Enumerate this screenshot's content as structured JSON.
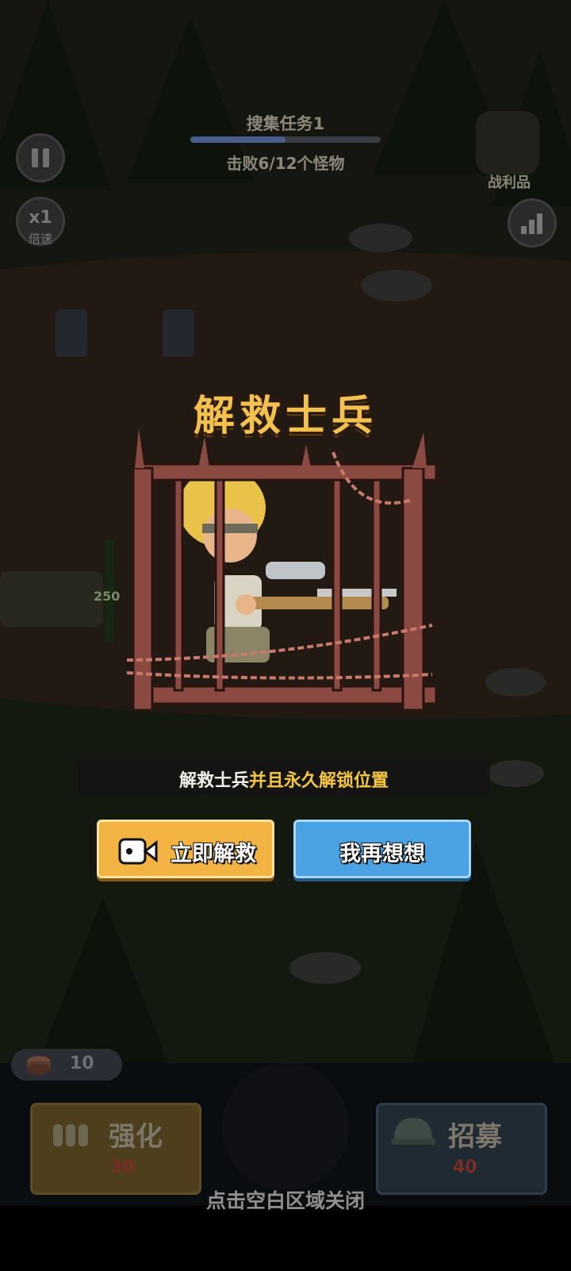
{
  "hud": {
    "quest_title": "搜集任务1",
    "quest_progress": "击败6/12个怪物",
    "quest_progress_fraction": 0.5,
    "speed_value": "x1",
    "speed_label": "倍速",
    "loot_label": "战利品",
    "wall_hp": "250"
  },
  "modal": {
    "title": "解救士兵",
    "description_white": "解救士兵",
    "description_yellow": "并且永久解锁位置",
    "rescue_button": "立即解救",
    "later_button": "我再想想"
  },
  "bottom": {
    "coins": "10",
    "upgrade_label": "强化",
    "upgrade_cost": "30",
    "recruit_label": "招募",
    "recruit_cost": "40",
    "close_hint": "点击空白区域关闭"
  },
  "colors": {
    "title_gold": "#f2c14e",
    "rescue_orange": "#f2b343",
    "later_blue": "#4aa2e2",
    "highlight_yellow": "#f6c744"
  },
  "icons": [
    "pause-icon",
    "signal-icon",
    "video-icon",
    "backpack-icon",
    "coin-icon",
    "bullets-icon",
    "helmet-icon",
    "lock-icon"
  ]
}
